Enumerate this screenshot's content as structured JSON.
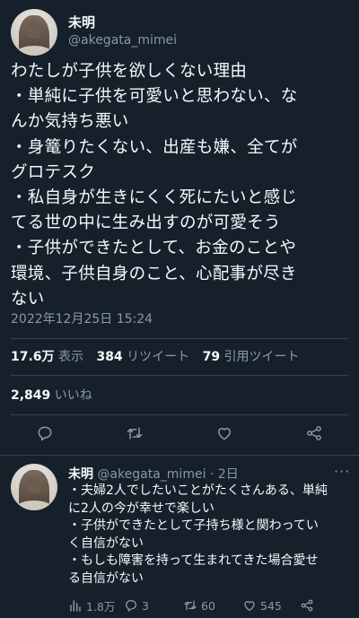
{
  "tweet": {
    "author_name": "未明",
    "author_handle": "@akegata_mimei",
    "text_lines": [
      "わたしが子供を欲しくない理由",
      "・単純に子供を可愛いと思わない、な",
      "んか気持ち悪い",
      "・身篭りたくない、出産も嫌、全てが",
      "グロテスク",
      "・私自身が生きにくく死にたいと感じ",
      "てる世の中に生み出すのが可愛そう",
      "・子供ができたとして、お金のことや",
      "環境、子供自身のこと、心配事が尽き",
      "ない"
    ],
    "timestamp": "2022年12月25日 15:24",
    "views_count": "17.6万",
    "views_label": "表示",
    "retweets_count": "384",
    "retweets_label": "リツイート",
    "quotes_count": "79",
    "quotes_label": "引用ツイート",
    "likes_count": "2,849",
    "likes_label": "いいね",
    "actions": {
      "reply_icon": "reply-icon",
      "retweet_icon": "retweet-icon",
      "like_icon": "heart-icon",
      "share_icon": "share-icon"
    }
  },
  "reply": {
    "author_name": "未明",
    "author_handle": "@akegata_mimei",
    "age": "· 2日",
    "more": "···",
    "text_lines": [
      "・夫婦2人でしたいことがたくさんある、単純",
      "に2人の今が幸せで楽しい",
      "・子供ができたとして子持ち様と関わってい",
      "く自信がない",
      "・もしも障害を持って生まれてきた場合愛せ",
      "る自信がない"
    ],
    "views": "1.8万",
    "replies": "3",
    "retweets": "60",
    "likes": "545"
  },
  "colors": {
    "background": "#15202b",
    "text_primary": "#f7f9f9",
    "text_secondary": "#8b98a5",
    "divider": "#38444d"
  }
}
